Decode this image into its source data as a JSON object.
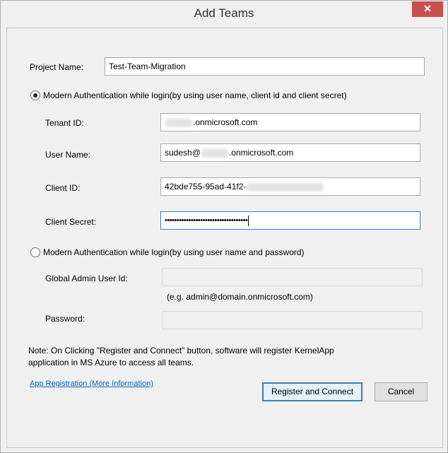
{
  "window": {
    "title": "Add Teams",
    "close_glyph": "✕"
  },
  "project": {
    "label": "Project Name:",
    "value": "Test-Team-Migration"
  },
  "modern_auth_client": {
    "label": "Modern Authentication while login(by using user name, client id and client secret)",
    "selected": true,
    "tenant_label": "Tenant ID:",
    "tenant_suffix": ".onmicrosoft.com",
    "username_label": "User Name:",
    "username_prefix": "sudesh@",
    "username_suffix": ".onmicrosoft.com",
    "client_id_label": "Client ID:",
    "client_id_value": "42bde755-95ad-41f2-",
    "client_secret_label": "Client Secret:",
    "client_secret_value": "•••••••••••••••••••••••••••••••••••"
  },
  "modern_auth_password": {
    "label": "Modern Authentication while login(by using user name and password)",
    "selected": false,
    "admin_label": "Global Admin User Id:",
    "admin_hint": "(e.g. admin@domain.onmicrosoft.com)",
    "password_label": "Password:"
  },
  "note": "Note: On Clicking \"Register and Connect\" button, software will register KernelApp application in MS Azure to access all teams.",
  "footer": {
    "link_label": "App Registration (More Information)",
    "register_label": "Register and Connect",
    "cancel_label": "Cancel"
  }
}
